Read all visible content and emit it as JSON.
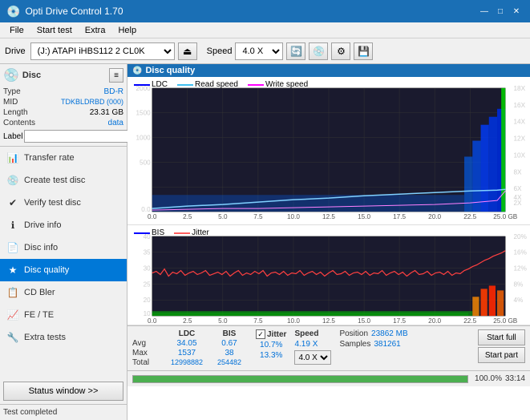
{
  "titleBar": {
    "title": "Opti Drive Control 1.70",
    "minimizeBtn": "—",
    "maximizeBtn": "□",
    "closeBtn": "✕"
  },
  "menuBar": {
    "items": [
      "File",
      "Start test",
      "Extra",
      "Help"
    ]
  },
  "toolbar": {
    "driveLabel": "Drive",
    "driveValue": "(J:) ATAPI iHBS112  2 CL0K",
    "speedLabel": "Speed",
    "speedValue": "4.0 X"
  },
  "leftPanel": {
    "discSection": {
      "title": "Disc",
      "rows": [
        {
          "label": "Type",
          "value": "BD-R"
        },
        {
          "label": "MID",
          "value": "TDKBLDRBD (000)"
        },
        {
          "label": "Length",
          "value": "23.31 GB"
        },
        {
          "label": "Contents",
          "value": "data"
        },
        {
          "label": "Label",
          "value": ""
        }
      ]
    },
    "navItems": [
      {
        "label": "Transfer rate",
        "icon": "📊",
        "active": false
      },
      {
        "label": "Create test disc",
        "icon": "💿",
        "active": false
      },
      {
        "label": "Verify test disc",
        "icon": "✔",
        "active": false
      },
      {
        "label": "Drive info",
        "icon": "ℹ",
        "active": false
      },
      {
        "label": "Disc info",
        "icon": "📄",
        "active": false
      },
      {
        "label": "Disc quality",
        "icon": "★",
        "active": true
      },
      {
        "label": "CD Bler",
        "icon": "📋",
        "active": false
      },
      {
        "label": "FE / TE",
        "icon": "📈",
        "active": false
      },
      {
        "label": "Extra tests",
        "icon": "🔧",
        "active": false
      }
    ],
    "statusWindowBtn": "Status window >>"
  },
  "chartTitle": "Disc quality",
  "legend": {
    "top": [
      {
        "label": "LDC",
        "color": "#0000ff"
      },
      {
        "label": "Read speed",
        "color": "#40c0f0"
      },
      {
        "label": "Write speed",
        "color": "#ff00ff"
      }
    ],
    "bottom": [
      {
        "label": "BIS",
        "color": "#0000ff"
      },
      {
        "label": "Jitter",
        "color": "#ff6060"
      }
    ]
  },
  "stats": {
    "headers": [
      "",
      "LDC",
      "BIS",
      "",
      "Jitter",
      "Speed"
    ],
    "avgLabel": "Avg",
    "avgLDC": "34.05",
    "avgBIS": "0.67",
    "avgJitter": "10.7%",
    "avgSpeed": "4.19 X",
    "maxLabel": "Max",
    "maxLDC": "1537",
    "maxBIS": "38",
    "maxJitter": "13.3%",
    "totalLabel": "Total",
    "totalLDC": "12998882",
    "totalBIS": "254482",
    "jitterLabel": "Jitter",
    "speedSelectValue": "4.0 X",
    "positionLabel": "Position",
    "positionValue": "23862 MB",
    "samplesLabel": "Samples",
    "samplesValue": "381261",
    "startFullBtn": "Start full",
    "startPartBtn": "Start part"
  },
  "bottomBar": {
    "statusText": "Test completed",
    "progressValue": 100,
    "progressText": "100.0%",
    "timeText": "33:14"
  }
}
